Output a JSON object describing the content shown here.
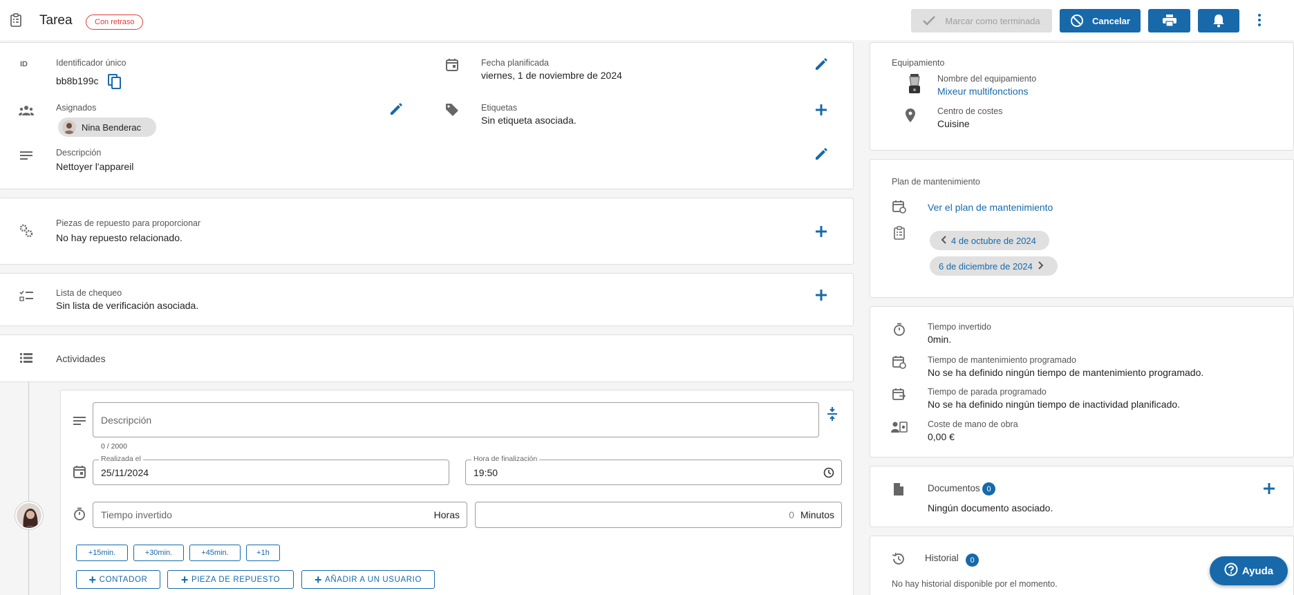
{
  "header": {
    "title": "Tarea",
    "status_badge": "Con retraso",
    "mark_done_label": "Marcar como terminada",
    "cancel_label": "Cancelar"
  },
  "details": {
    "id_icon_text": "ID",
    "id_label": "Identificador único",
    "id_value": "bb8b199c",
    "planned_date_label": "Fecha planificada",
    "planned_date_value": "viernes, 1 de noviembre de 2024",
    "assignees_label": "Asignados",
    "assignee_name": "Nina Benderac",
    "tags_label": "Etiquetas",
    "tags_value": "Sin etiqueta asociada.",
    "description_label": "Descripción",
    "description_value": "Nettoyer l'appareil"
  },
  "spare_parts": {
    "label": "Piezas de repuesto para proporcionar",
    "value": "No hay repuesto relacionado."
  },
  "checklist": {
    "label": "Lista de chequeo",
    "value": "Sin lista de verificación asociada."
  },
  "activities": {
    "title": "Actividades",
    "form": {
      "description_placeholder": "Descripción",
      "char_count": "0 / 2000",
      "done_on_label": "Realizada el",
      "done_on_value": "25/11/2024",
      "end_time_label": "Hora de finalización",
      "end_time_value": "19:50",
      "time_spent_placeholder": "Tiempo invertido",
      "hours_unit": "Horas",
      "minutes_value": "0",
      "minutes_unit": "Minutos",
      "quick_buttons": [
        "+15min.",
        "+30min.",
        "+45min.",
        "+1h"
      ],
      "add_counter": "CONTADOR",
      "add_spare_part": "PIEZA DE REPUESTO",
      "add_user": "AÑADIR A UN USUARIO"
    }
  },
  "equipment": {
    "section_label": "Equipamiento",
    "name_label": "Nombre del equipamiento",
    "name_value": "Mixeur multifonctions",
    "cost_center_label": "Centro de costes",
    "cost_center_value": "Cuisine"
  },
  "maintenance_plan": {
    "section_label": "Plan de mantenimiento",
    "view_link": "Ver el plan de mantenimiento",
    "prev_date": "4 de octubre de 2024",
    "next_date": "6 de diciembre de 2024"
  },
  "times": {
    "spent_label": "Tiempo invertido",
    "spent_value": "0min.",
    "scheduled_maintenance_label": "Tiempo de mantenimiento programado",
    "scheduled_maintenance_value": "No se ha definido ningún tiempo de mantenimiento programado.",
    "scheduled_downtime_label": "Tiempo de parada programado",
    "scheduled_downtime_value": "No se ha definido ningún tiempo de inactividad planificado.",
    "labor_cost_label": "Coste de mano de obra",
    "labor_cost_value": "0,00 €"
  },
  "documents": {
    "label": "Documentos",
    "count": "0",
    "value": "Ningún documento asociado."
  },
  "history": {
    "label": "Historial",
    "count": "0",
    "value": "No hay historial disponible por el momento."
  },
  "help_label": "Ayuda",
  "colors": {
    "primary": "#1769aa",
    "danger": "#e53935"
  }
}
